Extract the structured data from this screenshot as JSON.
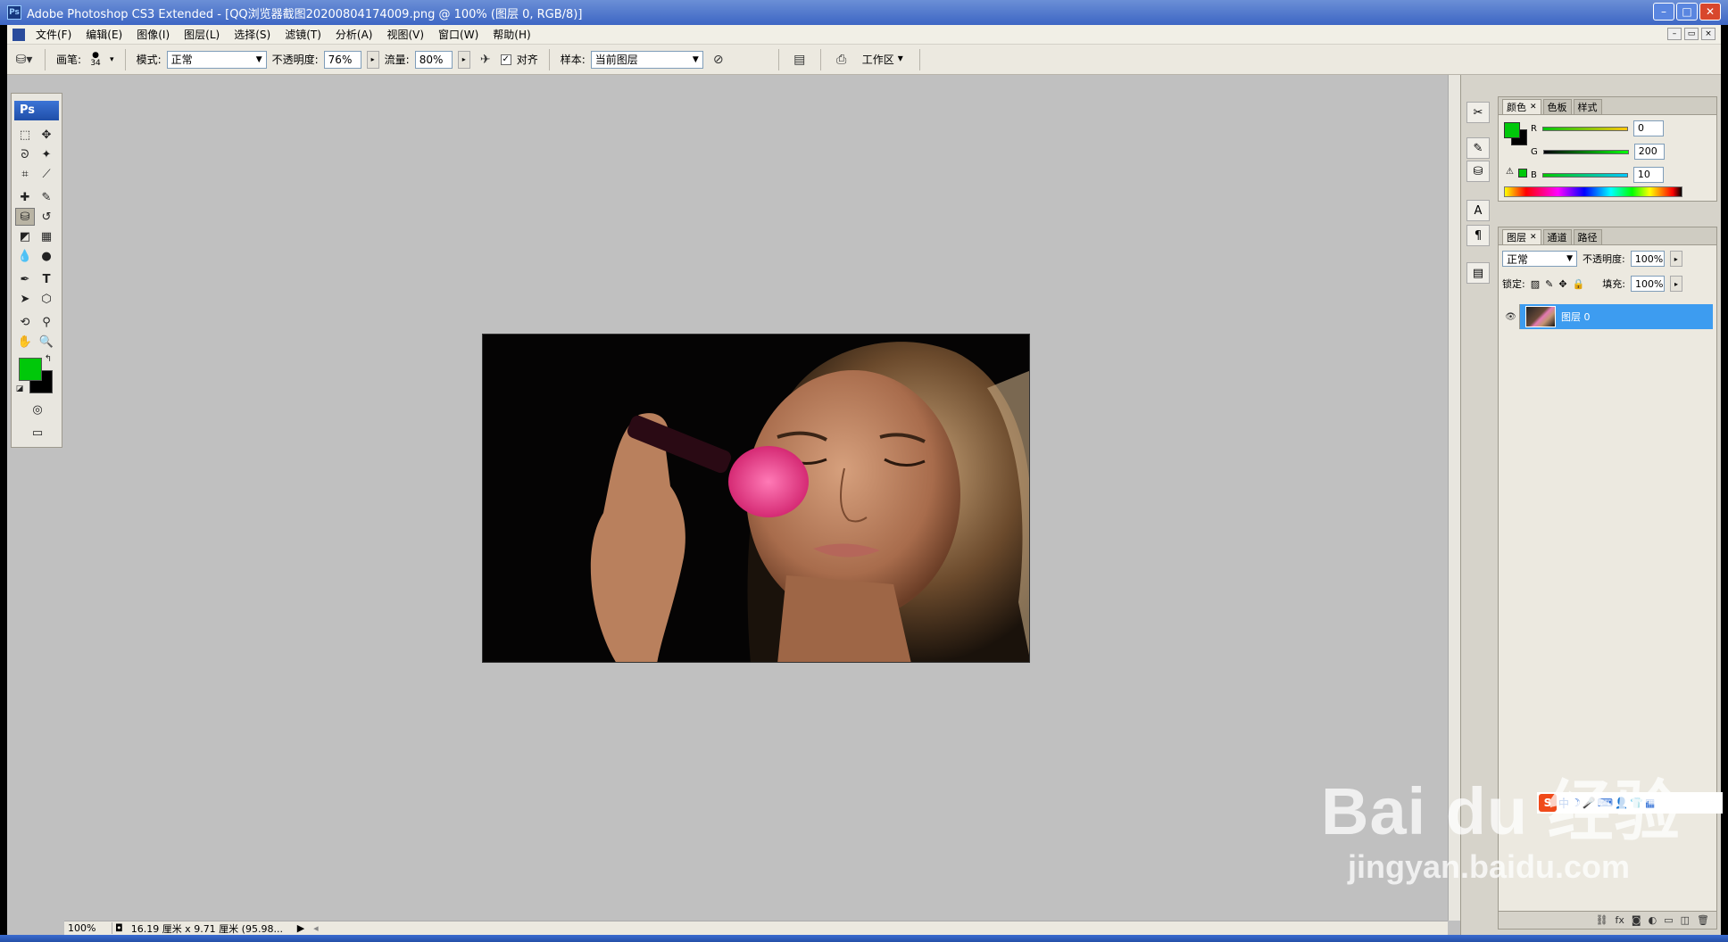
{
  "window": {
    "title": "Adobe Photoshop CS3 Extended - [QQ浏览器截图20200804174009.png @ 100% (图层 0, RGB/8)]",
    "app_icon": "Ps",
    "controls": {
      "minimize": "–",
      "maximize": "□",
      "close": "✕"
    }
  },
  "menu": {
    "items": [
      "文件(F)",
      "编辑(E)",
      "图像(I)",
      "图层(L)",
      "选择(S)",
      "滤镜(T)",
      "分析(A)",
      "视图(V)",
      "窗口(W)",
      "帮助(H)"
    ],
    "doc_controls": {
      "minimize": "–",
      "restore": "▭",
      "close": "×"
    }
  },
  "options_bar": {
    "brush_label": "画笔:",
    "brush_size": "34",
    "mode_label": "模式:",
    "mode_value": "正常",
    "opacity_label": "不透明度:",
    "opacity_value": "76%",
    "flow_label": "流量:",
    "flow_value": "80%",
    "aligned_label": "对齐",
    "aligned_checked": true,
    "sample_label": "样本:",
    "sample_value": "当前图层",
    "workspace_label": "工作区"
  },
  "toolbox": {
    "logo": "Ps",
    "foreground_color": "#00c80a",
    "background_color": "#000000",
    "tools": [
      "marquee-icon",
      "move-icon",
      "lasso-icon",
      "magic-wand-icon",
      "crop-icon",
      "slice-icon",
      "healing-brush-icon",
      "brush-icon",
      "clone-stamp-icon",
      "history-brush-icon",
      "eraser-icon",
      "gradient-icon",
      "blur-icon",
      "dodge-icon",
      "pen-icon",
      "type-icon",
      "path-selection-icon",
      "shape-icon",
      "3d-rotate-icon",
      "eyedropper-icon",
      "hand-icon",
      "zoom-icon"
    ],
    "selected_tool": "clone-stamp-icon"
  },
  "status": {
    "zoom": "100%",
    "doc_info": "16.19 厘米 x 9.71 厘米 (95.98..."
  },
  "color_panel": {
    "tabs": [
      "颜色",
      "色板",
      "样式"
    ],
    "active_tab": "颜色",
    "r_label": "R",
    "r_value": "0",
    "g_label": "G",
    "g_value": "200",
    "b_label": "B",
    "b_value": "10",
    "fg_color": "#00c80a"
  },
  "layers_panel": {
    "tabs": [
      "图层",
      "通道",
      "路径"
    ],
    "active_tab": "图层",
    "blend_mode": "正常",
    "opacity_label": "不透明度:",
    "opacity_value": "100%",
    "lock_label": "锁定:",
    "fill_label": "填充:",
    "fill_value": "100%",
    "layers": [
      {
        "name": "图层 0",
        "visible": true,
        "selected": true
      }
    ]
  },
  "watermark": {
    "line1": "Bai du 经验",
    "line2": "jingyan.baidu.com"
  },
  "ime": {
    "badge": "S",
    "text": "中"
  },
  "colors": {
    "title_bar": "#3d66c4",
    "selection": "#3d9cf0",
    "workspace": "#c0c0c0",
    "brush_pink": "#e3407f"
  }
}
